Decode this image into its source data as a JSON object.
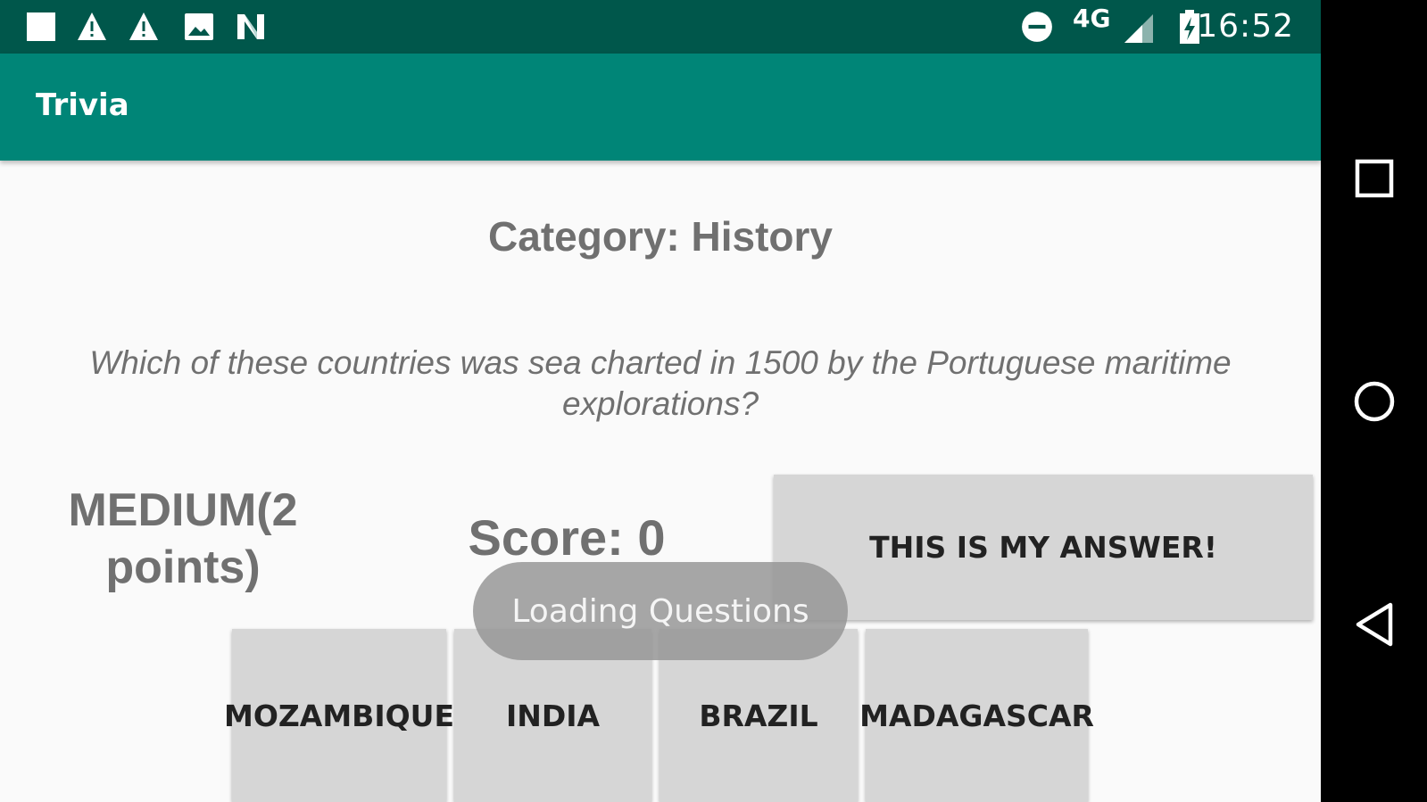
{
  "status_bar": {
    "time": "16:52",
    "network": "4G",
    "icons": [
      "square-notification-icon",
      "warning-icon",
      "warning-icon",
      "image-icon",
      "n-logo-icon",
      "do-not-disturb-icon",
      "signal-icon",
      "battery-charging-icon"
    ]
  },
  "app_bar": {
    "title": "Trivia"
  },
  "main": {
    "category": "Category: History",
    "question": "Which of these countries was sea charted in 1500 by the Portuguese maritime explorations?",
    "difficulty": "MEDIUM(2 points)",
    "score": "Score: 0",
    "submit_label": "THIS IS MY ANSWER!",
    "answers": [
      {
        "label": "MOZAMBIQUE"
      },
      {
        "label": "INDIA"
      },
      {
        "label": "BRAZIL"
      },
      {
        "label": "MADAGASCAR"
      }
    ]
  },
  "toast": {
    "text": "Loading Questions"
  },
  "nav_bar": {
    "buttons": [
      "recents-button",
      "home-button",
      "back-button"
    ]
  },
  "colors": {
    "status_bar": "#00574b",
    "app_bar": "#008577",
    "button": "#d6d6d6",
    "text_gray": "#707070"
  }
}
